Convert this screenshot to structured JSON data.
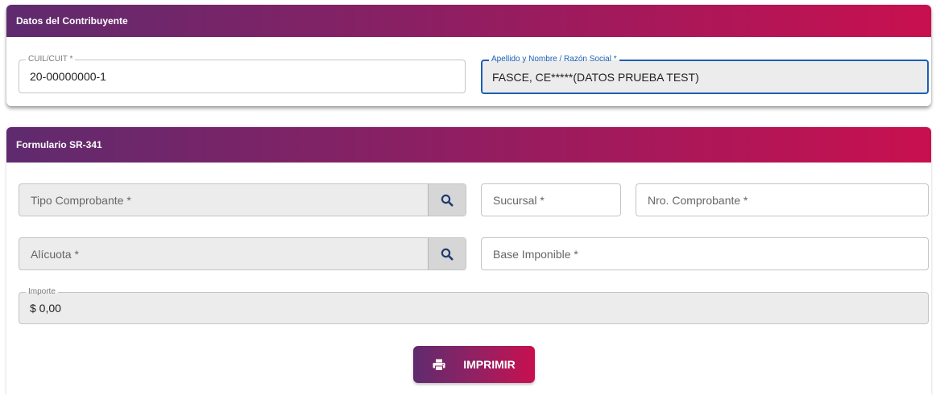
{
  "contribuyente": {
    "title": "Datos del Contribuyente",
    "cuil": {
      "label": "CUIL/CUIT *",
      "value": "20-00000000-1"
    },
    "nombre": {
      "label": "Apellido y Nombre / Razón Social *",
      "value": "FASCE, CE*****(DATOS PRUEBA TEST)"
    }
  },
  "formulario": {
    "title": "Formulario SR-341",
    "tipo_comprobante": {
      "placeholder": "Tipo Comprobante *",
      "search_icon": "search-icon"
    },
    "sucursal": {
      "placeholder": "Sucursal *"
    },
    "nro_comprobante": {
      "placeholder": "Nro. Comprobante *"
    },
    "alicuota": {
      "placeholder": "Alícuota *",
      "search_icon": "search-icon"
    },
    "base_imponible": {
      "placeholder": "Base Imponible *"
    },
    "importe": {
      "label": "Importe",
      "value": "$ 0,00"
    },
    "print_button": {
      "label": "IMPRIMIR",
      "icon": "printer-icon"
    }
  },
  "colors": {
    "header_gradient_start": "#5f2b6e",
    "header_gradient_end": "#c8104f",
    "focus_blue": "#1b5fb5",
    "search_icon_color": "#1f3b6e"
  }
}
